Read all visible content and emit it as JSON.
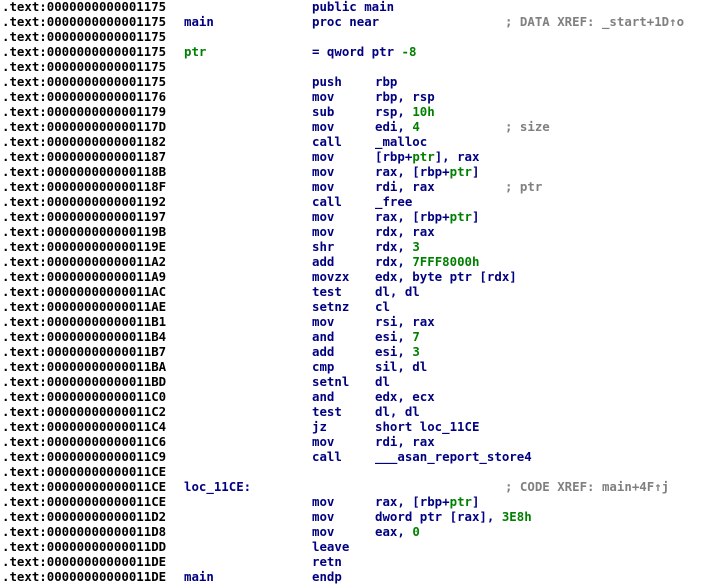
{
  "colors": {
    "address": "#000000",
    "instruction": "#000080",
    "label": "#000080",
    "stack_var": "#008000",
    "number": "#008000",
    "comment": "#808080",
    "background": "#ffffff"
  },
  "lines": [
    {
      "addr": ".text:0000000000001175",
      "label": "",
      "mnem": "public main",
      "ops": "",
      "cmt": ""
    },
    {
      "addr": ".text:0000000000001175",
      "label": "main",
      "mnem": "proc near",
      "ops": "",
      "cmt": "; DATA XREF: _start+1D↑o"
    },
    {
      "addr": ".text:0000000000001175",
      "label": "",
      "mnem": "",
      "ops": "",
      "cmt": ""
    },
    {
      "addr": ".text:0000000000001175",
      "label": "ptr",
      "mnem": "= qword ptr -8",
      "ops": "",
      "cmt": "",
      "labelClass": "c-name"
    },
    {
      "addr": ".text:0000000000001175",
      "label": "",
      "mnem": "",
      "ops": "",
      "cmt": ""
    },
    {
      "addr": ".text:0000000000001175",
      "label": "",
      "mnem": "push",
      "ops": "rbp",
      "cmt": ""
    },
    {
      "addr": ".text:0000000000001176",
      "label": "",
      "mnem": "mov",
      "ops": "rbp, rsp",
      "cmt": ""
    },
    {
      "addr": ".text:0000000000001179",
      "label": "",
      "mnem": "sub",
      "ops": "rsp, 10h",
      "cmt": ""
    },
    {
      "addr": ".text:000000000000117D",
      "label": "",
      "mnem": "mov",
      "ops": "edi, 4",
      "cmt": "; size"
    },
    {
      "addr": ".text:0000000000001182",
      "label": "",
      "mnem": "call",
      "ops": "_malloc",
      "cmt": ""
    },
    {
      "addr": ".text:0000000000001187",
      "label": "",
      "mnem": "mov",
      "ops": "[rbp+ptr], rax",
      "cmt": ""
    },
    {
      "addr": ".text:000000000000118B",
      "label": "",
      "mnem": "mov",
      "ops": "rax, [rbp+ptr]",
      "cmt": ""
    },
    {
      "addr": ".text:000000000000118F",
      "label": "",
      "mnem": "mov",
      "ops": "rdi, rax",
      "cmt": "; ptr"
    },
    {
      "addr": ".text:0000000000001192",
      "label": "",
      "mnem": "call",
      "ops": "_free",
      "cmt": ""
    },
    {
      "addr": ".text:0000000000001197",
      "label": "",
      "mnem": "mov",
      "ops": "rax, [rbp+ptr]",
      "cmt": ""
    },
    {
      "addr": ".text:000000000000119B",
      "label": "",
      "mnem": "mov",
      "ops": "rdx, rax",
      "cmt": ""
    },
    {
      "addr": ".text:000000000000119E",
      "label": "",
      "mnem": "shr",
      "ops": "rdx, 3",
      "cmt": ""
    },
    {
      "addr": ".text:00000000000011A2",
      "label": "",
      "mnem": "add",
      "ops": "rdx, 7FFF8000h",
      "cmt": ""
    },
    {
      "addr": ".text:00000000000011A9",
      "label": "",
      "mnem": "movzx",
      "ops": "edx, byte ptr [rdx]",
      "cmt": ""
    },
    {
      "addr": ".text:00000000000011AC",
      "label": "",
      "mnem": "test",
      "ops": "dl, dl",
      "cmt": ""
    },
    {
      "addr": ".text:00000000000011AE",
      "label": "",
      "mnem": "setnz",
      "ops": "cl",
      "cmt": ""
    },
    {
      "addr": ".text:00000000000011B1",
      "label": "",
      "mnem": "mov",
      "ops": "rsi, rax",
      "cmt": ""
    },
    {
      "addr": ".text:00000000000011B4",
      "label": "",
      "mnem": "and",
      "ops": "esi, 7",
      "cmt": ""
    },
    {
      "addr": ".text:00000000000011B7",
      "label": "",
      "mnem": "add",
      "ops": "esi, 3",
      "cmt": ""
    },
    {
      "addr": ".text:00000000000011BA",
      "label": "",
      "mnem": "cmp",
      "ops": "sil, dl",
      "cmt": ""
    },
    {
      "addr": ".text:00000000000011BD",
      "label": "",
      "mnem": "setnl",
      "ops": "dl",
      "cmt": ""
    },
    {
      "addr": ".text:00000000000011C0",
      "label": "",
      "mnem": "and",
      "ops": "edx, ecx",
      "cmt": ""
    },
    {
      "addr": ".text:00000000000011C2",
      "label": "",
      "mnem": "test",
      "ops": "dl, dl",
      "cmt": ""
    },
    {
      "addr": ".text:00000000000011C4",
      "label": "",
      "mnem": "jz",
      "ops": "short loc_11CE",
      "cmt": ""
    },
    {
      "addr": ".text:00000000000011C6",
      "label": "",
      "mnem": "mov",
      "ops": "rdi, rax",
      "cmt": ""
    },
    {
      "addr": ".text:00000000000011C9",
      "label": "",
      "mnem": "call",
      "ops": "___asan_report_store4",
      "cmt": ""
    },
    {
      "addr": ".text:00000000000011CE",
      "label": "",
      "mnem": "",
      "ops": "",
      "cmt": ""
    },
    {
      "addr": ".text:00000000000011CE",
      "label": "loc_11CE:",
      "mnem": "",
      "ops": "",
      "cmt": "; CODE XREF: main+4F↑j"
    },
    {
      "addr": ".text:00000000000011CE",
      "label": "",
      "mnem": "mov",
      "ops": "rax, [rbp+ptr]",
      "cmt": ""
    },
    {
      "addr": ".text:00000000000011D2",
      "label": "",
      "mnem": "mov",
      "ops": "dword ptr [rax], 3E8h",
      "cmt": ""
    },
    {
      "addr": ".text:00000000000011D8",
      "label": "",
      "mnem": "mov",
      "ops": "eax, 0",
      "cmt": ""
    },
    {
      "addr": ".text:00000000000011DD",
      "label": "",
      "mnem": "leave",
      "ops": "",
      "cmt": ""
    },
    {
      "addr": ".text:00000000000011DE",
      "label": "",
      "mnem": "retn",
      "ops": "",
      "cmt": ""
    },
    {
      "addr": ".text:00000000000011DE",
      "label": "main",
      "mnem": "endp",
      "ops": "",
      "cmt": ""
    }
  ]
}
